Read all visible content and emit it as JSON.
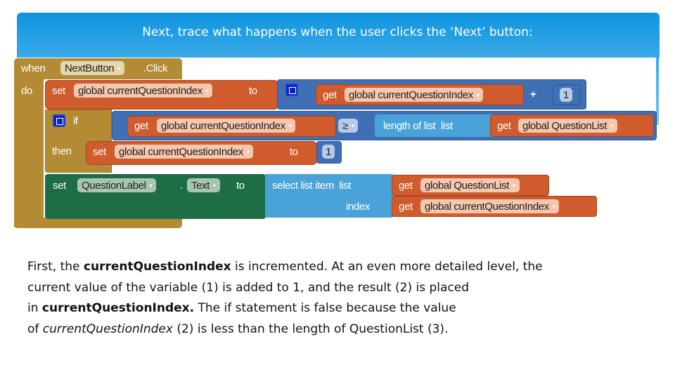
{
  "slide": {
    "title": "Next, trace what happens when the user clicks the ‘Next’ button:",
    "body": {
      "line1_a": "First, the ",
      "line1_b": "currentQuestionIndex",
      "line1_c": " is incremented. At an even more detailed level, the",
      "line2": "current value of the variable (1) is added to 1, and the result (2) is placed",
      "line3_a": "in ",
      "line3_b": "currentQuestionIndex.",
      "line3_c": " The if statement is false because the value",
      "line4_a": "of ",
      "line4_b": "currentQuestionIndex",
      "line4_c": " (2) is less than the length of QuestionList (3)."
    }
  },
  "blocks": {
    "event": {
      "when": "when",
      "component": "NextButton",
      "event": ".Click",
      "do": "do"
    },
    "set1": {
      "set": "set",
      "var": "global currentQuestionIndex",
      "to": "to"
    },
    "add": {
      "get": "get",
      "var": "global currentQuestionIndex",
      "op": "+",
      "num": "1"
    },
    "if": {
      "if": "if",
      "then": "then"
    },
    "compare": {
      "get": "get",
      "var": "global currentQuestionIndex",
      "op": "≥"
    },
    "length": {
      "label": "length of list  list",
      "get": "get",
      "var": "global QuestionList"
    },
    "set2": {
      "set": "set",
      "var": "global currentQuestionIndex",
      "to": "to",
      "num": "1"
    },
    "set3": {
      "set": "set",
      "component": "QuestionLabel",
      "dot": ".",
      "prop": "Text",
      "to": "to"
    },
    "select": {
      "label": "select list item  list",
      "index": "index",
      "get1": "get",
      "var1": "global QuestionList",
      "get2": "get",
      "var2": "global currentQuestionIndex"
    }
  },
  "dropdown_glyph": "▾"
}
